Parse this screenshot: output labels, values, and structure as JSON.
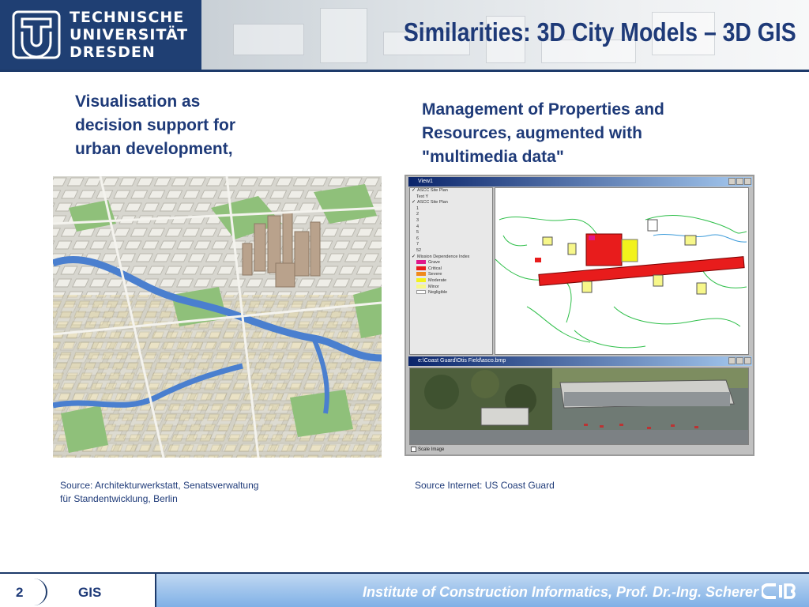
{
  "header": {
    "logo_lines": [
      "TECHNISCHE",
      "UNIVERSITÄT",
      "DRESDEN"
    ],
    "title": "Similarities: 3D City Models – 3D GIS"
  },
  "left": {
    "heading_lines": [
      "Visualisation as",
      "decision support for",
      "urban development,"
    ],
    "source_lines": [
      "Source: Architekturwerkstatt, Senatsverwaltung",
      "für Standentwicklung, Berlin"
    ]
  },
  "right": {
    "heading_lines": [
      "Management of Properties and",
      "Resources, augmented with",
      "\"multimedia data\""
    ],
    "source": "Source Internet: US Coast Guard",
    "window_title": "View1",
    "photo_title": "e:\\Coast Guard\\Otis Field\\asco.bmp",
    "toc": {
      "group1": "ASCC Site Plan",
      "group1_sub": "Text Y",
      "group2": "ASCC Site Plan",
      "group2_items": [
        "1",
        "2",
        "3",
        "4",
        "5",
        "6",
        "7",
        "52"
      ],
      "group3": "Mission Dependence Index",
      "legend": [
        {
          "label": "Grave",
          "color": "#e0178a"
        },
        {
          "label": "Critical",
          "color": "#e81c1c"
        },
        {
          "label": "Severe",
          "color": "#f08a1c"
        },
        {
          "label": "Moderate",
          "color": "#f2f21c"
        },
        {
          "label": "Minor",
          "color": "#f7f78a"
        },
        {
          "label": "Negligible",
          "color": "#ffffff"
        }
      ]
    },
    "scale_label": "Scale Image"
  },
  "footer": {
    "page_number": "2",
    "section": "GIS",
    "institute": "Institute of Construction Informatics, Prof. Dr.-Ing. Scherer"
  },
  "colors": {
    "brand_blue": "#1f3f73",
    "title_blue": "#1e3a78",
    "footer_bar": "#7fb0e6"
  }
}
